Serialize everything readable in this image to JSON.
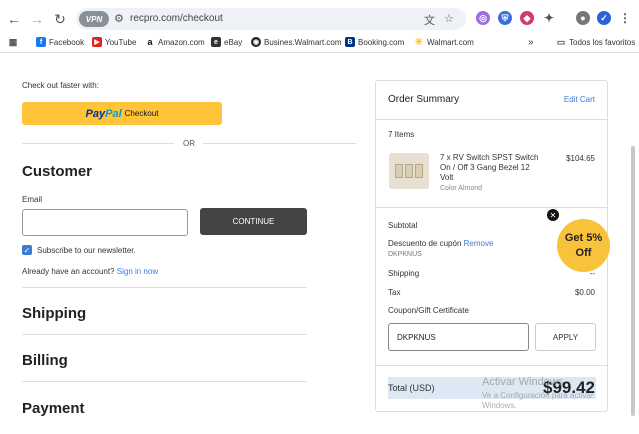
{
  "browser": {
    "url": "recpro.com/checkout",
    "vpn_label": "VPN",
    "bookmarks": [
      "Facebook",
      "YouTube",
      "Amazon.com",
      "eBay",
      "Busines.Walmart.com",
      "Booking.com",
      "Walmart.com"
    ],
    "more_bookmarks_label": "»",
    "all_bookmarks_label": "Todos los favoritos"
  },
  "checkout": {
    "faster_label": "Check out faster with:",
    "paypal": {
      "brand1": "Pay",
      "brand2": "Pal",
      "suffix": "Checkout"
    },
    "or_label": "OR",
    "customer_title": "Customer",
    "email_label": "Email",
    "email_value": "",
    "continue_label": "CONTINUE",
    "subscribe_label": "Subscribe to our newsletter.",
    "already_account": "Already have an account?",
    "sign_in_label": "Sign in now",
    "shipping_title": "Shipping",
    "billing_title": "Billing",
    "payment_title": "Payment"
  },
  "summary": {
    "title": "Order Summary",
    "edit_cart": "Edit Cart",
    "items_count": "7 Items",
    "item": {
      "name": "7 x RV Switch SPST Switch On / Off 3 Gang Bezel 12 Volt",
      "variant": "Color Almond",
      "price": "$104.65"
    },
    "subtotal_label": "Subtotal",
    "discount_label": "Descuento de cupón",
    "remove_label": "Remove",
    "discount_code": "DKPKNUS",
    "shipping_label": "Shipping",
    "shipping_value": "--",
    "tax_label": "Tax",
    "tax_value": "$0.00",
    "coupon_link": "Coupon/Gift Certificate",
    "coupon_value": "DKPKNUS",
    "apply_label": "APPLY",
    "total_label": "Total (USD)",
    "total_value": "$99.42"
  },
  "promo": {
    "line1": "Get 5%",
    "line2": "Off",
    "close": "✕"
  },
  "watermark": {
    "title": "Activar Windows",
    "subtitle": "Ve a Configuración para activar Windows."
  }
}
